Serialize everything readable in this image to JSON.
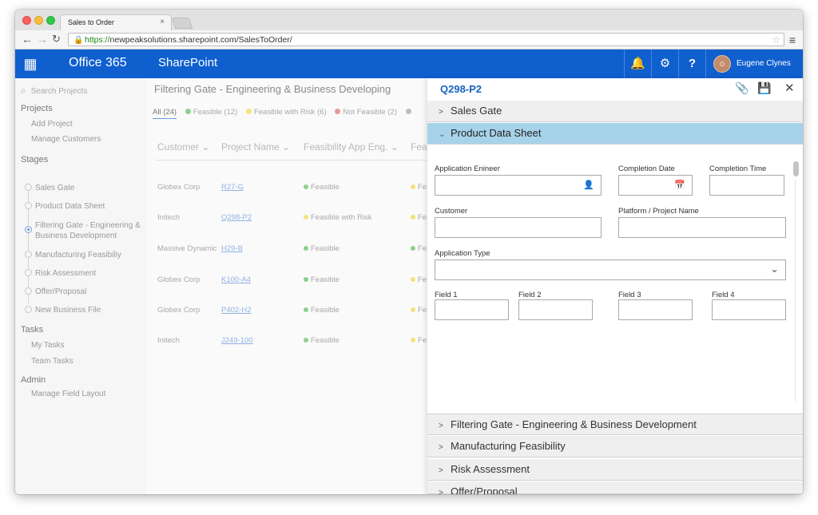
{
  "browser": {
    "tab_title": "Sales to Order",
    "tab_close": "×",
    "url_scheme": "https://",
    "url_rest": "newpeaksolutions.sharepoint.com/SalesToOrder/"
  },
  "suite": {
    "app_name": "Office 365",
    "site_name": "SharePoint",
    "user_name": "Eugene Clynes"
  },
  "sidebar": {
    "search_placeholder": "Search Projects",
    "projects_heading": "Projects",
    "projects_items": [
      "Add Project",
      "Manage Customers"
    ],
    "stages_heading": "Stages",
    "stages": [
      "Sales Gate",
      "Product Data Sheet",
      "Filtering Gate - Engineering &",
      "Business Development",
      "Manufacturing Feasibiliy",
      "Risk Assessment",
      "Offer/Proposal",
      "New Business File"
    ],
    "tasks_heading": "Tasks",
    "tasks_items": [
      "My Tasks",
      "Team Tasks"
    ],
    "admin_heading": "Admin",
    "admin_items": [
      "Manage Field Layout"
    ]
  },
  "main": {
    "title": "Filtering Gate - Engineering & Business Developing",
    "filters": {
      "all": "All (24)",
      "feasible": "Feasible (12)",
      "risk": "Feasible with Risk (6)",
      "not": "Not Feasible (2)"
    },
    "columns": [
      "Customer",
      "Project Name",
      "Feasibility App Eng.",
      "Fea"
    ],
    "rows": [
      {
        "customer": "Globex Corp",
        "code": "R27-G",
        "status": "Feasible",
        "cut": "Fe"
      },
      {
        "customer": "Initech",
        "code": "Q298-P2",
        "status": "Feasible with Risk",
        "cut": "Fe"
      },
      {
        "customer": "Massive Dynamic",
        "code": "H29-B",
        "status": "Feasible",
        "cut": "Fe"
      },
      {
        "customer": "Globex Corp",
        "code": "K100-A4",
        "status": "Feasible",
        "cut": "Fe"
      },
      {
        "customer": "Globex Corp",
        "code": "P402-H2",
        "status": "Feasible",
        "cut": "Fe"
      },
      {
        "customer": "Initech",
        "code": "J249-100",
        "status": "Feasible",
        "cut": "Fe"
      }
    ],
    "status_colors": {
      "feasible": "#8fcf8f",
      "risk": "#f3e27a",
      "not": "#e89a9a",
      "other": "#bdbdbd"
    }
  },
  "panel": {
    "title": "Q298-P2",
    "sections": {
      "sales_gate": "Sales Gate",
      "product_data_sheet": "Product Data Sheet",
      "filtering_gate": "Filtering Gate - Engineering & Business Development",
      "manufacturing": "Manufacturing Feasibility",
      "risk": "Risk Assessment",
      "offer": "Offer/Proposal"
    },
    "fields": {
      "application_engineer": "Application Enineer",
      "completion_date": "Completion Date",
      "completion_time": "Completion Time",
      "customer": "Customer",
      "platform": "Platform / Project Name",
      "application_type": "Application Type",
      "field1": "Field 1",
      "field2": "Field 2",
      "field3": "Field 3",
      "field4": "Field 4"
    }
  },
  "colors": {
    "suite_blue": "#0f5fcf",
    "accordion_open": "#a7d3ea",
    "title_blue": "#1565c0"
  }
}
